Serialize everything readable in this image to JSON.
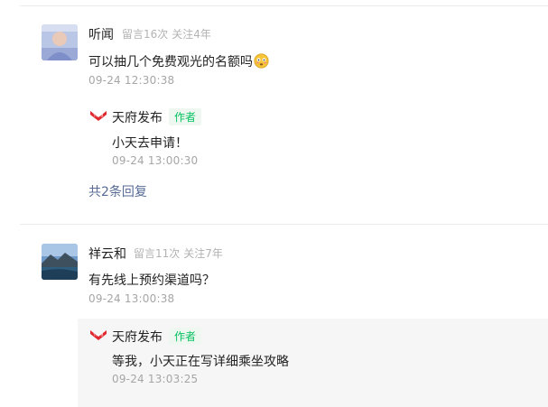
{
  "comments": [
    {
      "name": "听闻",
      "stats": [
        "留言16次",
        "关注4年"
      ],
      "content": "可以抽几个免费观光的名额吗",
      "time": "09-24 12:30:38",
      "reply": {
        "author": "天府发布",
        "badge": "作者",
        "content": "小天去申请！",
        "time": "09-24 13:00:30"
      },
      "more_replies": "共2条回复"
    },
    {
      "name": "祥云和",
      "stats": [
        "留言11次",
        "关注7年"
      ],
      "content": "有先线上预约渠道吗？",
      "time": "09-24 13:00:38",
      "reply": {
        "author": "天府发布",
        "badge": "作者",
        "content": "等我，小天正在写详细乘坐攻略",
        "time": "09-24 13:03:25"
      }
    }
  ],
  "colors": {
    "author_badge": "#07c160",
    "link": "#576b95",
    "meta": "#b3b3b3",
    "logo_red": "#e0282e"
  },
  "icons": {
    "avatar_1": "user-avatar-photo",
    "avatar_2": "landscape-avatar-photo",
    "emoji": "flushed-emoji",
    "brand_logo": "tianfu-brand-logo"
  }
}
